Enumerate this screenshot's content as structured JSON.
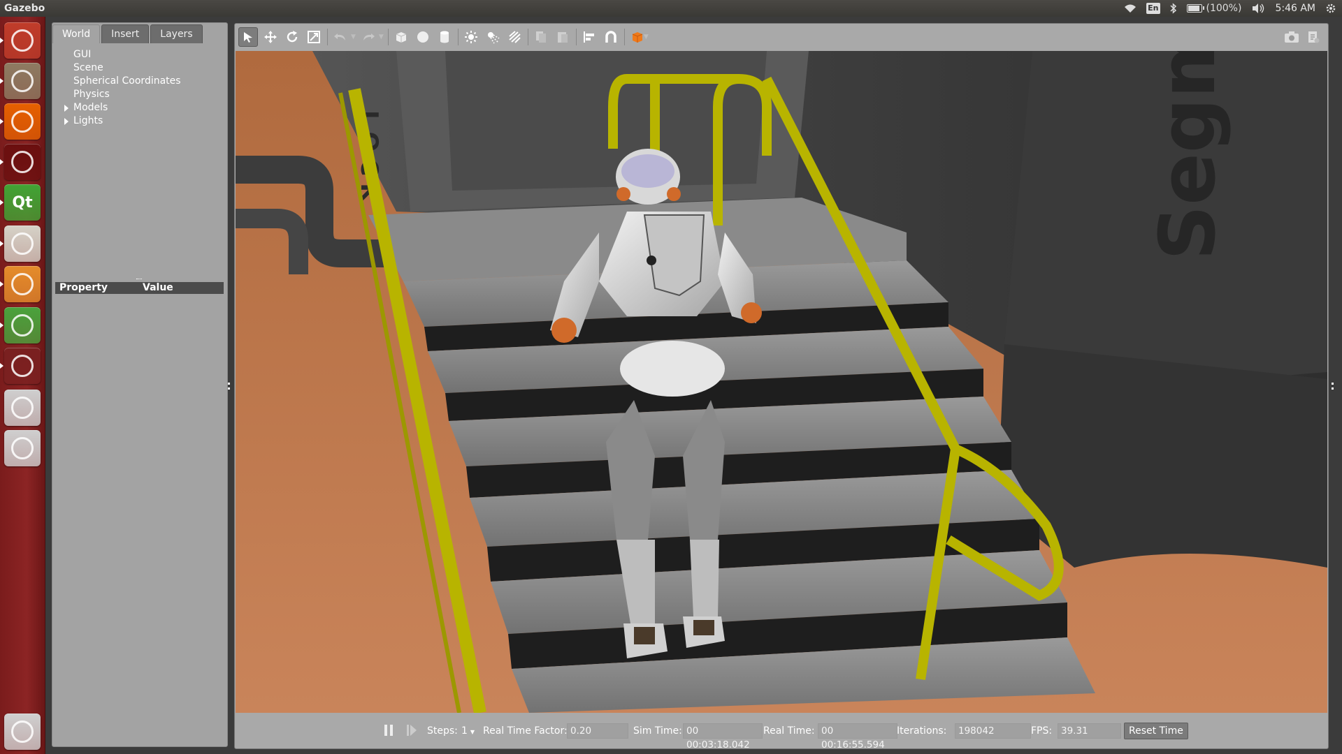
{
  "window": {
    "title": "Gazebo"
  },
  "tray": {
    "keyboard": "En",
    "battery_text": "(100%)",
    "battery_fraction": 1.0,
    "clock": "5:46 AM"
  },
  "launcher": {
    "items": [
      {
        "name": "dash-icon",
        "color": "#c03c2a"
      },
      {
        "name": "files-icon",
        "color": "#8e7b62"
      },
      {
        "name": "firefox-icon",
        "color": "#e66000"
      },
      {
        "name": "terminal-window-icon",
        "color": "#6b0f0f"
      },
      {
        "name": "qt-creator-icon",
        "label": "Qt",
        "color": "#41a334"
      },
      {
        "name": "text-editor-icon",
        "color": "#d6d2c8"
      },
      {
        "name": "gazebo-icon",
        "color": "#e58c2b"
      },
      {
        "name": "software-updater-icon",
        "color": "#4aa23c"
      },
      {
        "name": "workspace-switcher-icon",
        "color": "#7a2020"
      },
      {
        "name": "drive-icon",
        "color": "#cfcfcf"
      },
      {
        "name": "drive-2-icon",
        "color": "#cfcfcf"
      },
      {
        "name": "trash-icon",
        "color": "#d0d0d0"
      }
    ]
  },
  "left_panel": {
    "tabs": [
      "World",
      "Insert",
      "Layers"
    ],
    "active_tab": "World",
    "tree": [
      {
        "label": "GUI",
        "expandable": false
      },
      {
        "label": "Scene",
        "expandable": false
      },
      {
        "label": "Spherical Coordinates",
        "expandable": false
      },
      {
        "label": "Physics",
        "expandable": false
      },
      {
        "label": "Models",
        "expandable": true
      },
      {
        "label": "Lights",
        "expandable": true
      }
    ],
    "property_header": {
      "property": "Property",
      "value": "Value"
    }
  },
  "toolbar": {
    "tools": [
      "select-mode-icon",
      "translate-mode-icon",
      "rotate-mode-icon",
      "scale-mode-icon",
      "undo-icon",
      "redo-icon",
      "box-shape-icon",
      "sphere-shape-icon",
      "cylinder-shape-icon",
      "point-light-icon",
      "spot-light-icon",
      "directional-light-icon",
      "copy-icon",
      "paste-icon",
      "align-icon",
      "snap-icon",
      "change-view-icon",
      "screenshot-icon",
      "log-icon"
    ]
  },
  "scene": {
    "wall_lettering": "Segm",
    "door_lettering": "LOCK"
  },
  "bottom_bar": {
    "steps_label": "Steps:",
    "steps_value": "1",
    "real_time_factor_label": "Real Time Factor:",
    "real_time_factor_value": "0.20",
    "sim_time_label": "Sim Time:",
    "sim_time_value": "00 00:03:18.042",
    "real_time_label": "Real Time:",
    "real_time_value": "00 00:16:55.594",
    "iterations_label": "Iterations:",
    "iterations_value": "198042",
    "fps_label": "FPS:",
    "fps_value": "39.31",
    "reset_label": "Reset Time"
  }
}
